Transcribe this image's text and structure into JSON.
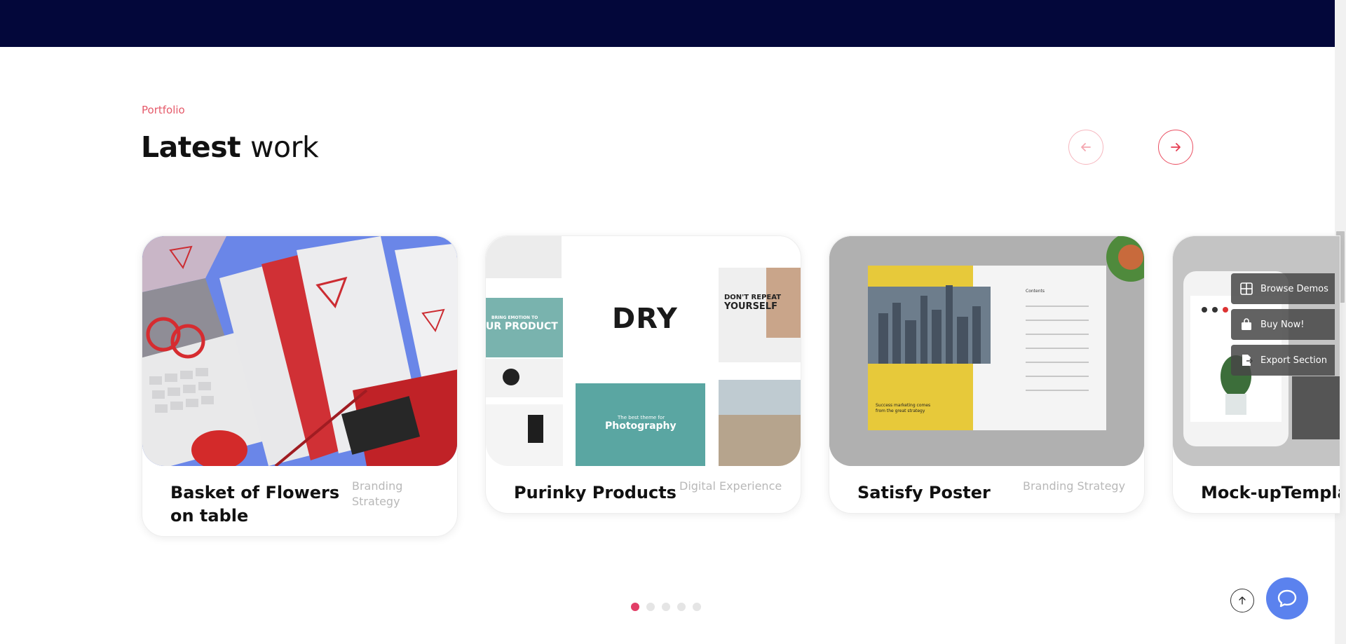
{
  "section": {
    "eyebrow": "Portfolio",
    "heading_bold": "Latest",
    "heading_light": "work"
  },
  "nav": {
    "prev_icon": "arrow-left-icon",
    "next_icon": "arrow-right-icon"
  },
  "cards": [
    {
      "title": "Basket of Flowers on table",
      "category": "Branding Strategy"
    },
    {
      "title": "Purinky Products",
      "category": "Digital Experience",
      "image_text": "DRY",
      "image_subtext_1": "BRING EMOTION TO",
      "image_subtext_2": "UR PRODUCT",
      "image_subtext_3": "The best theme for",
      "image_subtext_4": "Photography",
      "image_subtext_5": "DON'T REPEAT",
      "image_subtext_6": "YOURSELF"
    },
    {
      "title": "Satisfy Poster",
      "category": "Branding Strategy",
      "image_subtext_1": "Contents",
      "image_subtext_2": "Success marketing comes",
      "image_subtext_3": "from the great strategy"
    },
    {
      "title": "Mock-upTempla",
      "category": ""
    }
  ],
  "pagination": {
    "count": 5,
    "active": 1
  },
  "float_menu": [
    {
      "label": "Browse Demos",
      "icon": "grid-icon"
    },
    {
      "label": "Buy Now!",
      "icon": "bag-icon"
    },
    {
      "label": "Export Section",
      "icon": "export-icon"
    }
  ],
  "colors": {
    "accent": "#e55a6a",
    "topbar": "#03073a",
    "chat": "#5b82ee"
  }
}
